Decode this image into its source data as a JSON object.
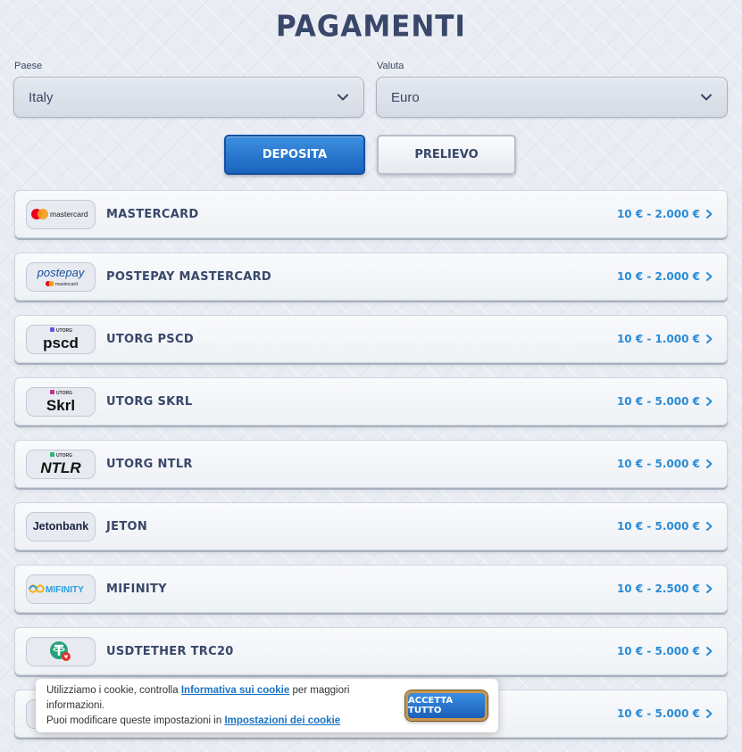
{
  "page": {
    "title": "PAGAMENTI"
  },
  "filters": {
    "country_label": "Paese",
    "country_value": "Italy",
    "currency_label": "Valuta",
    "currency_value": "Euro"
  },
  "tabs": [
    {
      "label": "DEPOSITA",
      "active": true
    },
    {
      "label": "PRELIEVO",
      "active": false
    }
  ],
  "methods": [
    {
      "name": "MASTERCARD",
      "range": "10 € - 2.000 €",
      "logo": "mastercard",
      "logo_text": "mastercard"
    },
    {
      "name": "POSTEPAY MASTERCARD",
      "range": "10 € - 2.000 €",
      "logo": "postepay",
      "logo_text": "postepay",
      "logo_sub": "mastercard"
    },
    {
      "name": "UTORG PSCD",
      "range": "10 € - 1.000 €",
      "logo": "utorg-pscd",
      "logo_text": "pscd",
      "logo_sub": "UTORG"
    },
    {
      "name": "UTORG SKRL",
      "range": "10 € - 5.000 €",
      "logo": "utorg-skrl",
      "logo_text": "Skrl",
      "logo_sub": "UTORG"
    },
    {
      "name": "UTORG NTLR",
      "range": "10 € - 5.000 €",
      "logo": "utorg-ntlr",
      "logo_text": "NTLR",
      "logo_sub": "UTORG"
    },
    {
      "name": "JETON",
      "range": "10 € - 5.000 €",
      "logo": "jetonbank",
      "logo_text": "Jetonbank"
    },
    {
      "name": "MIFINITY",
      "range": "10 € - 2.500 €",
      "logo": "mifinity",
      "logo_text": "MIFINITY"
    },
    {
      "name": "USDTETHER TRC20",
      "range": "10 € - 5.000 €",
      "logo": "tether"
    },
    {
      "name": "",
      "range": "10 € - 5.000 €",
      "logo": ""
    }
  ],
  "cookie": {
    "line1_prefix": "Utilizziamo i cookie, controlla ",
    "line1_link": "Informativa sui cookie",
    "line1_suffix": " per maggiori informazioni.",
    "line2_prefix": "Puoi modificare queste impostazioni in ",
    "line2_link": "Impostazioni dei cookie",
    "accept_label": "ACCETTA TUTTO"
  },
  "colors": {
    "accent": "#2a8bd6",
    "primary_button": "#1a63bd",
    "title": "#38476a"
  }
}
